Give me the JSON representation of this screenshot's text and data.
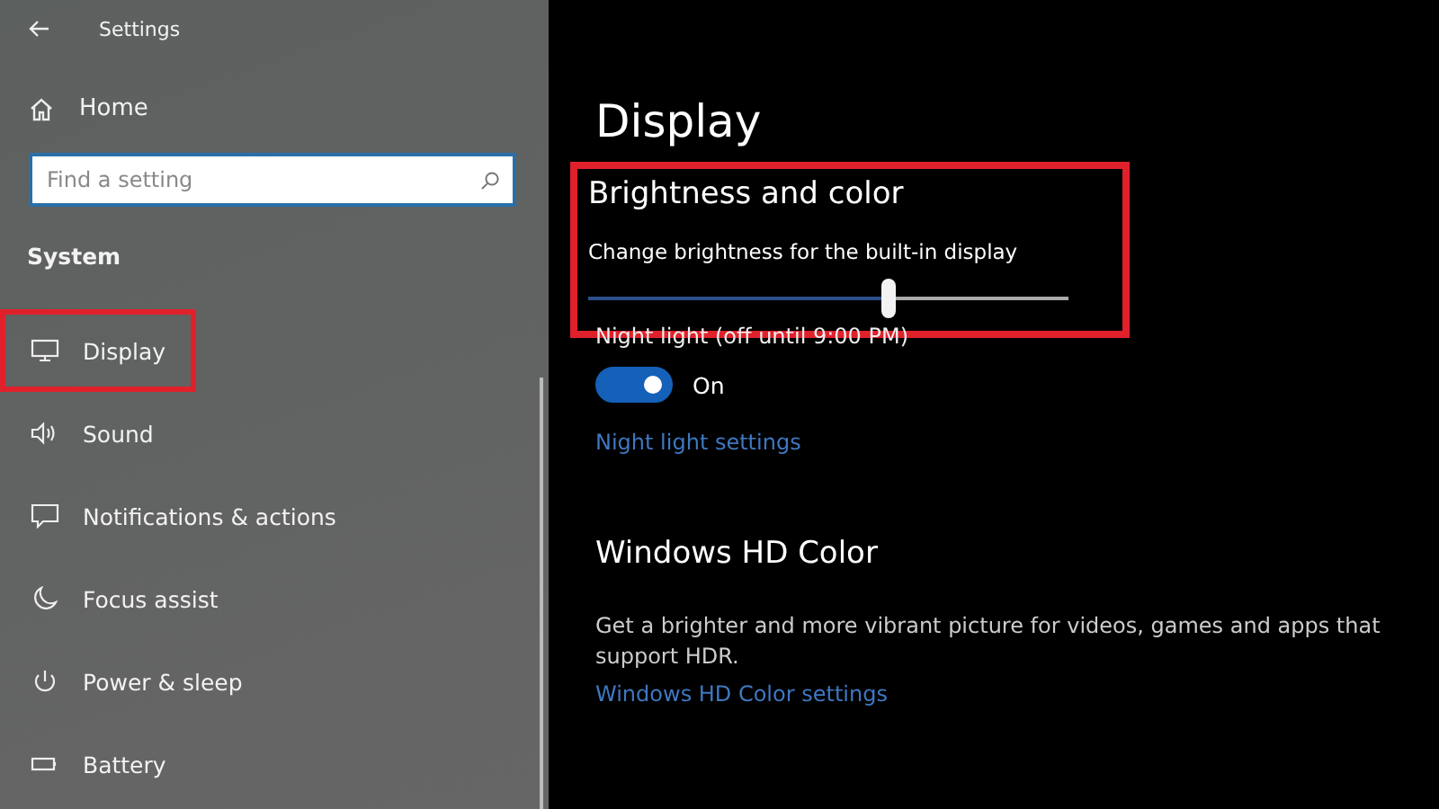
{
  "window": {
    "title": "Settings"
  },
  "sidebar": {
    "home": "Home",
    "search": {
      "placeholder": "Find a setting"
    },
    "section": "System",
    "items": [
      {
        "label": "Display",
        "highlighted": true
      },
      {
        "label": "Sound",
        "highlighted": false
      },
      {
        "label": "Notifications & actions",
        "highlighted": false
      },
      {
        "label": "Focus assist",
        "highlighted": false
      },
      {
        "label": "Power & sleep",
        "highlighted": false
      },
      {
        "label": "Battery",
        "highlighted": false
      }
    ]
  },
  "page": {
    "title": "Display",
    "brightness": {
      "heading": "Brightness and color",
      "highlighted": true,
      "slider_label": "Change brightness for the built-in display",
      "level": 0.625
    },
    "night_light": {
      "label": "Night light (off until 9:00 PM)",
      "on": true,
      "state_text": "On",
      "link": "Night light settings"
    },
    "hd_color": {
      "heading": "Windows HD Color",
      "description": "Get a brighter and more vibrant picture for videos, games and apps that support HDR.",
      "link": "Windows HD Color settings"
    }
  }
}
